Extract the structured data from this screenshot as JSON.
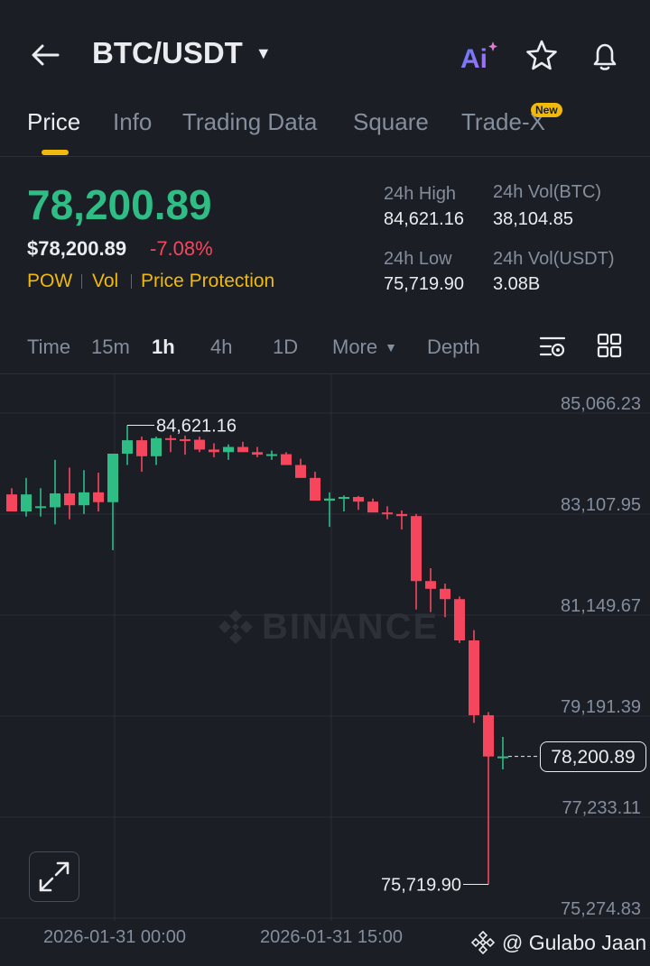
{
  "header": {
    "pair": "BTC/USDT",
    "ai_label": "Ai"
  },
  "tabs": [
    {
      "label": "Price",
      "active": true
    },
    {
      "label": "Info"
    },
    {
      "label": "Trading Data"
    },
    {
      "label": "Square"
    },
    {
      "label": "Trade-X",
      "badge": "New"
    }
  ],
  "ticker": {
    "last_price": "78,200.89",
    "usd_price": "$78,200.89",
    "change_pct": "-7.08%",
    "tags": [
      "POW",
      "Vol",
      "Price Protection"
    ],
    "high_label": "24h High",
    "high_value": "84,621.16",
    "low_label": "24h Low",
    "low_value": "75,719.90",
    "vol_btc_label": "24h Vol(BTC)",
    "vol_btc_value": "38,104.85",
    "vol_usdt_label": "24h Vol(USDT)",
    "vol_usdt_value": "3.08B"
  },
  "timeframes": [
    "Time",
    "15m",
    "1h",
    "4h",
    "1D",
    "More",
    "Depth"
  ],
  "active_timeframe": "1h",
  "colors": {
    "up": "#2ebd85",
    "down": "#f6465d",
    "accent": "#f0b90b"
  },
  "chart_data": {
    "type": "candlestick",
    "price_axis": [
      "85,066.23",
      "83,107.95",
      "81,149.67",
      "79,191.39",
      "77,233.11",
      "75,274.83"
    ],
    "time_axis": [
      "2026-01-31 00:00",
      "2026-01-31 15:00"
    ],
    "high_marker": "84,621.16",
    "low_marker": "75,719.90",
    "current_price": "78,200.89",
    "watermark": "BINANCE",
    "candles": [
      {
        "o": 83280,
        "h": 83400,
        "l": 82950,
        "c": 82950
      },
      {
        "o": 82950,
        "h": 83600,
        "l": 82850,
        "c": 83280
      },
      {
        "o": 83050,
        "h": 83400,
        "l": 82850,
        "c": 83050
      },
      {
        "o": 83030,
        "h": 83950,
        "l": 82700,
        "c": 83300
      },
      {
        "o": 83300,
        "h": 83800,
        "l": 82800,
        "c": 83070
      },
      {
        "o": 83070,
        "h": 83750,
        "l": 82900,
        "c": 83320
      },
      {
        "o": 83320,
        "h": 83700,
        "l": 82950,
        "c": 83130
      },
      {
        "o": 83130,
        "h": 84000,
        "l": 82200,
        "c": 84070
      },
      {
        "o": 84070,
        "h": 84621.16,
        "l": 83850,
        "c": 84330
      },
      {
        "o": 84330,
        "h": 84400,
        "l": 83720,
        "c": 84020
      },
      {
        "o": 84020,
        "h": 84400,
        "l": 83850,
        "c": 84370
      },
      {
        "o": 84370,
        "h": 84430,
        "l": 84100,
        "c": 84350
      },
      {
        "o": 84350,
        "h": 84420,
        "l": 84050,
        "c": 84340
      },
      {
        "o": 84340,
        "h": 84400,
        "l": 84100,
        "c": 84150
      },
      {
        "o": 84150,
        "h": 84270,
        "l": 84000,
        "c": 84100
      },
      {
        "o": 84100,
        "h": 84250,
        "l": 83950,
        "c": 84200
      },
      {
        "o": 84200,
        "h": 84300,
        "l": 84100,
        "c": 84100
      },
      {
        "o": 84100,
        "h": 84200,
        "l": 84000,
        "c": 84050
      },
      {
        "o": 84050,
        "h": 84130,
        "l": 83950,
        "c": 84060
      },
      {
        "o": 84060,
        "h": 84100,
        "l": 83920,
        "c": 83850
      },
      {
        "o": 83850,
        "h": 83970,
        "l": 83650,
        "c": 83600
      },
      {
        "o": 83600,
        "h": 83720,
        "l": 83300,
        "c": 83160
      },
      {
        "o": 83160,
        "h": 83320,
        "l": 82650,
        "c": 83200
      },
      {
        "o": 83200,
        "h": 83260,
        "l": 82950,
        "c": 83230
      },
      {
        "o": 83230,
        "h": 83250,
        "l": 82980,
        "c": 83140
      },
      {
        "o": 83140,
        "h": 83200,
        "l": 82950,
        "c": 82930
      },
      {
        "o": 82930,
        "h": 83050,
        "l": 82800,
        "c": 82900
      },
      {
        "o": 82900,
        "h": 82970,
        "l": 82600,
        "c": 82860
      },
      {
        "o": 82860,
        "h": 82900,
        "l": 81050,
        "c": 81600
      },
      {
        "o": 81600,
        "h": 81850,
        "l": 81000,
        "c": 81450
      },
      {
        "o": 81450,
        "h": 81550,
        "l": 80900,
        "c": 81250
      },
      {
        "o": 81250,
        "h": 81300,
        "l": 80400,
        "c": 80450
      },
      {
        "o": 80450,
        "h": 80650,
        "l": 78850,
        "c": 79000
      },
      {
        "o": 79000,
        "h": 79060,
        "l": 75719.9,
        "c": 78200
      },
      {
        "o": 78200,
        "h": 78580,
        "l": 77950,
        "c": 78200.89
      }
    ]
  },
  "credit": "@ Gulabo Jaan"
}
